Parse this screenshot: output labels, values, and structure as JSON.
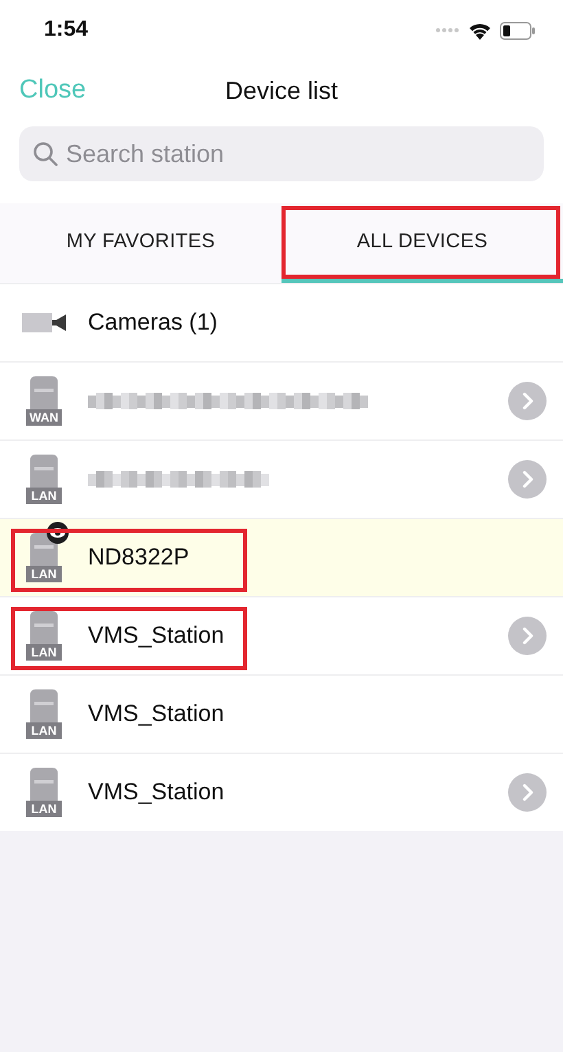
{
  "status_bar": {
    "time": "1:54"
  },
  "nav": {
    "close": "Close",
    "title": "Device list"
  },
  "search": {
    "placeholder": "Search station"
  },
  "tabs": [
    {
      "label": "MY FAVORITES",
      "selected": false,
      "annotated": false
    },
    {
      "label": "ALL DEVICES",
      "selected": true,
      "annotated": true
    }
  ],
  "rows": [
    {
      "kind": "camera",
      "name": "Cameras (1)",
      "selected": false,
      "annotated": false,
      "has_arrow": false
    },
    {
      "kind": "blurred",
      "badge": "WAN",
      "selected": false,
      "annotated": false,
      "has_arrow": true
    },
    {
      "kind": "blurred",
      "badge": "LAN",
      "selected": false,
      "annotated": false,
      "has_arrow": true
    },
    {
      "kind": "station",
      "badge": "LAN",
      "name": "ND8322P",
      "watching": true,
      "selected": true,
      "annotated": true,
      "has_arrow": false
    },
    {
      "kind": "station",
      "badge": "LAN",
      "name": "VMS_Station",
      "watching": false,
      "selected": false,
      "annotated": true,
      "has_arrow": true
    },
    {
      "kind": "station",
      "badge": "LAN",
      "name": "VMS_Station",
      "watching": false,
      "selected": false,
      "annotated": false,
      "has_arrow": false
    },
    {
      "kind": "station",
      "badge": "LAN",
      "name": "VMS_Station",
      "watching": false,
      "selected": false,
      "annotated": false,
      "has_arrow": true
    }
  ]
}
